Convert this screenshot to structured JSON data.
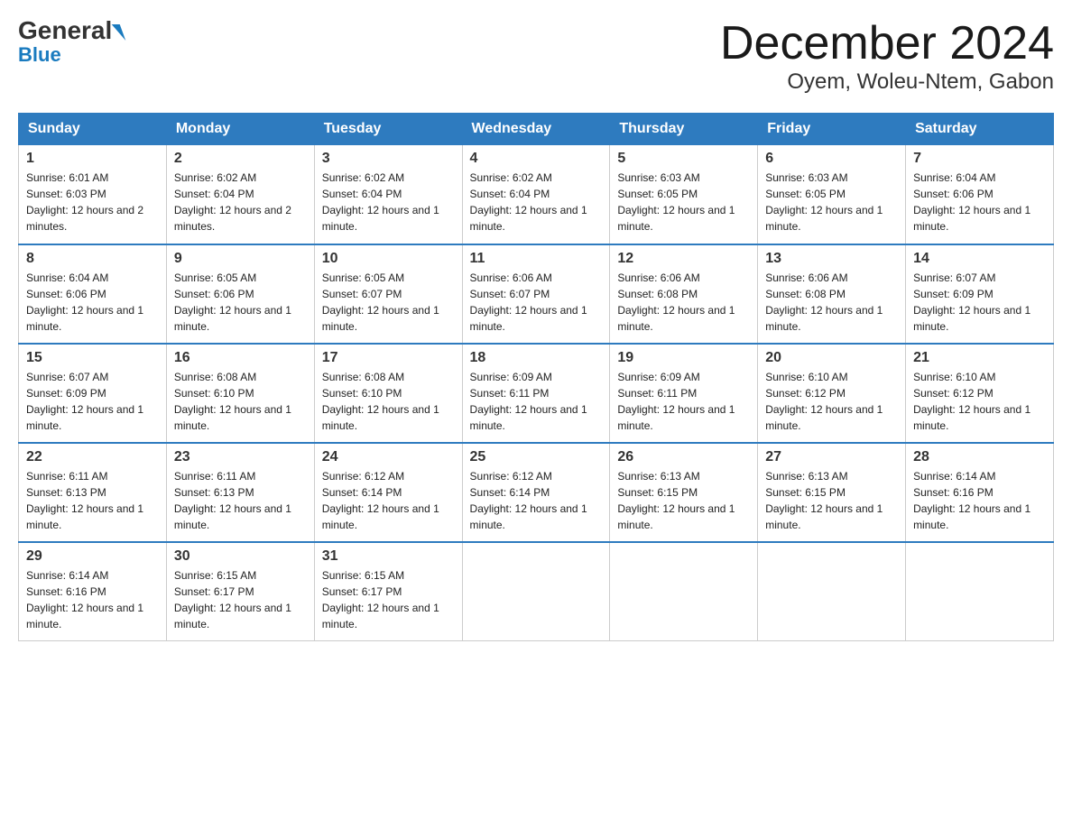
{
  "logo": {
    "part1": "General",
    "part2": "Blue"
  },
  "header": {
    "month": "December 2024",
    "location": "Oyem, Woleu-Ntem, Gabon"
  },
  "weekdays": [
    "Sunday",
    "Monday",
    "Tuesday",
    "Wednesday",
    "Thursday",
    "Friday",
    "Saturday"
  ],
  "weeks": [
    [
      {
        "day": "1",
        "sunrise": "6:01 AM",
        "sunset": "6:03 PM",
        "daylight": "12 hours and 2 minutes."
      },
      {
        "day": "2",
        "sunrise": "6:02 AM",
        "sunset": "6:04 PM",
        "daylight": "12 hours and 2 minutes."
      },
      {
        "day": "3",
        "sunrise": "6:02 AM",
        "sunset": "6:04 PM",
        "daylight": "12 hours and 1 minute."
      },
      {
        "day": "4",
        "sunrise": "6:02 AM",
        "sunset": "6:04 PM",
        "daylight": "12 hours and 1 minute."
      },
      {
        "day": "5",
        "sunrise": "6:03 AM",
        "sunset": "6:05 PM",
        "daylight": "12 hours and 1 minute."
      },
      {
        "day": "6",
        "sunrise": "6:03 AM",
        "sunset": "6:05 PM",
        "daylight": "12 hours and 1 minute."
      },
      {
        "day": "7",
        "sunrise": "6:04 AM",
        "sunset": "6:06 PM",
        "daylight": "12 hours and 1 minute."
      }
    ],
    [
      {
        "day": "8",
        "sunrise": "6:04 AM",
        "sunset": "6:06 PM",
        "daylight": "12 hours and 1 minute."
      },
      {
        "day": "9",
        "sunrise": "6:05 AM",
        "sunset": "6:06 PM",
        "daylight": "12 hours and 1 minute."
      },
      {
        "day": "10",
        "sunrise": "6:05 AM",
        "sunset": "6:07 PM",
        "daylight": "12 hours and 1 minute."
      },
      {
        "day": "11",
        "sunrise": "6:06 AM",
        "sunset": "6:07 PM",
        "daylight": "12 hours and 1 minute."
      },
      {
        "day": "12",
        "sunrise": "6:06 AM",
        "sunset": "6:08 PM",
        "daylight": "12 hours and 1 minute."
      },
      {
        "day": "13",
        "sunrise": "6:06 AM",
        "sunset": "6:08 PM",
        "daylight": "12 hours and 1 minute."
      },
      {
        "day": "14",
        "sunrise": "6:07 AM",
        "sunset": "6:09 PM",
        "daylight": "12 hours and 1 minute."
      }
    ],
    [
      {
        "day": "15",
        "sunrise": "6:07 AM",
        "sunset": "6:09 PM",
        "daylight": "12 hours and 1 minute."
      },
      {
        "day": "16",
        "sunrise": "6:08 AM",
        "sunset": "6:10 PM",
        "daylight": "12 hours and 1 minute."
      },
      {
        "day": "17",
        "sunrise": "6:08 AM",
        "sunset": "6:10 PM",
        "daylight": "12 hours and 1 minute."
      },
      {
        "day": "18",
        "sunrise": "6:09 AM",
        "sunset": "6:11 PM",
        "daylight": "12 hours and 1 minute."
      },
      {
        "day": "19",
        "sunrise": "6:09 AM",
        "sunset": "6:11 PM",
        "daylight": "12 hours and 1 minute."
      },
      {
        "day": "20",
        "sunrise": "6:10 AM",
        "sunset": "6:12 PM",
        "daylight": "12 hours and 1 minute."
      },
      {
        "day": "21",
        "sunrise": "6:10 AM",
        "sunset": "6:12 PM",
        "daylight": "12 hours and 1 minute."
      }
    ],
    [
      {
        "day": "22",
        "sunrise": "6:11 AM",
        "sunset": "6:13 PM",
        "daylight": "12 hours and 1 minute."
      },
      {
        "day": "23",
        "sunrise": "6:11 AM",
        "sunset": "6:13 PM",
        "daylight": "12 hours and 1 minute."
      },
      {
        "day": "24",
        "sunrise": "6:12 AM",
        "sunset": "6:14 PM",
        "daylight": "12 hours and 1 minute."
      },
      {
        "day": "25",
        "sunrise": "6:12 AM",
        "sunset": "6:14 PM",
        "daylight": "12 hours and 1 minute."
      },
      {
        "day": "26",
        "sunrise": "6:13 AM",
        "sunset": "6:15 PM",
        "daylight": "12 hours and 1 minute."
      },
      {
        "day": "27",
        "sunrise": "6:13 AM",
        "sunset": "6:15 PM",
        "daylight": "12 hours and 1 minute."
      },
      {
        "day": "28",
        "sunrise": "6:14 AM",
        "sunset": "6:16 PM",
        "daylight": "12 hours and 1 minute."
      }
    ],
    [
      {
        "day": "29",
        "sunrise": "6:14 AM",
        "sunset": "6:16 PM",
        "daylight": "12 hours and 1 minute."
      },
      {
        "day": "30",
        "sunrise": "6:15 AM",
        "sunset": "6:17 PM",
        "daylight": "12 hours and 1 minute."
      },
      {
        "day": "31",
        "sunrise": "6:15 AM",
        "sunset": "6:17 PM",
        "daylight": "12 hours and 1 minute."
      },
      null,
      null,
      null,
      null
    ]
  ]
}
